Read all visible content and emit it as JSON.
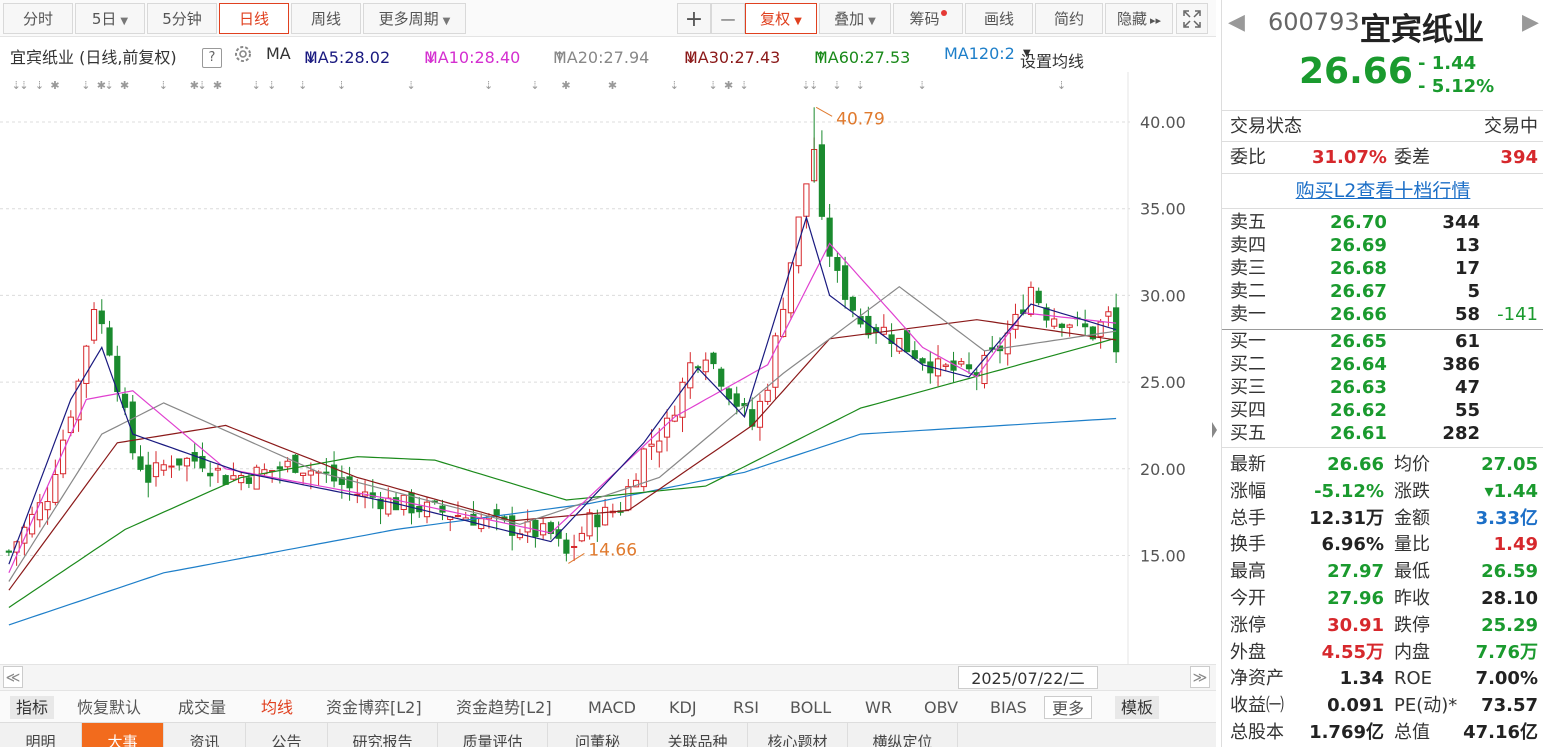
{
  "toolbar": {
    "periods": [
      "分时",
      "5日",
      "5分钟",
      "日线",
      "周线",
      "更多周期"
    ],
    "active_period": "日线",
    "tools": [
      "+",
      "—"
    ],
    "fuquan": "复权",
    "overlay": "叠加",
    "chouma": "筹码",
    "huaxian": "画线",
    "jianyue": "简约",
    "hide": "隐藏",
    "hide_arrows": "▸▸",
    "fullscreen_icon": "fullscreen"
  },
  "maline": {
    "stock_label": "宜宾纸业 (日线,前复权)",
    "help": "?",
    "ma_label": "MA",
    "ma5": "MA5:28.02",
    "ma5_arrow": "↓",
    "ma10": "MA10:28.40",
    "ma10_arrow": "↓",
    "ma20": "MA20:27.94",
    "ma20_arrow": "↑",
    "ma30": "MA30:27.43",
    "ma30_arrow": "↓",
    "ma60": "MA60:27.53",
    "ma60_arrow": "↑",
    "ma120": "MA120:2",
    "set_ma": "设置均线",
    "colors": {
      "ma5": "#1a1a80",
      "ma10": "#e040d0",
      "ma20": "#888888",
      "ma30": "#8b1a1a",
      "ma60": "#1b8a1b",
      "ma120": "#1e7fc9"
    }
  },
  "chart_data": {
    "type": "candlestick",
    "y_ticks": [
      "40.00",
      "35.00",
      "30.00",
      "25.00",
      "20.00",
      "15.00"
    ],
    "y_tick_values": [
      40,
      35,
      30,
      25,
      20,
      15
    ],
    "max_label": "40.79",
    "min_label": "14.66",
    "last_close": 26.66,
    "up_color": "#d6282c",
    "down_color": "#1a8a2e",
    "anchor_closes": [
      [
        0,
        15.2
      ],
      [
        5,
        18.5
      ],
      [
        9,
        25.0
      ],
      [
        11,
        29.5
      ],
      [
        13,
        27.0
      ],
      [
        16,
        21.0
      ],
      [
        18,
        19.5
      ],
      [
        21,
        20.5
      ],
      [
        25,
        20.5
      ],
      [
        28,
        19.5
      ],
      [
        33,
        19.8
      ],
      [
        37,
        20.3
      ],
      [
        41,
        19.6
      ],
      [
        45,
        18.6
      ],
      [
        50,
        18.0
      ],
      [
        55,
        17.6
      ],
      [
        60,
        17.2
      ],
      [
        65,
        16.6
      ],
      [
        70,
        16.2
      ],
      [
        72,
        15.0
      ],
      [
        75,
        17.0
      ],
      [
        79,
        17.8
      ],
      [
        82,
        21.0
      ],
      [
        85,
        22.5
      ],
      [
        88,
        26.0
      ],
      [
        90,
        26.8
      ],
      [
        93,
        24.5
      ],
      [
        96,
        22.5
      ],
      [
        98,
        25.0
      ],
      [
        101,
        32.0
      ],
      [
        103,
        36.5
      ],
      [
        104,
        38.5
      ],
      [
        105,
        34.0
      ],
      [
        107,
        31.0
      ],
      [
        110,
        28.5
      ],
      [
        113,
        28.0
      ],
      [
        116,
        27.0
      ],
      [
        120,
        25.8
      ],
      [
        125,
        25.5
      ],
      [
        128,
        27.0
      ],
      [
        130,
        28.5
      ],
      [
        132,
        30.5
      ],
      [
        134,
        29.0
      ],
      [
        137,
        28.5
      ],
      [
        140,
        27.8
      ],
      [
        142,
        28.8
      ],
      [
        143,
        26.66
      ]
    ],
    "ma_curves": {
      "ma120": [
        [
          0,
          11.0
        ],
        [
          20,
          14.0
        ],
        [
          50,
          16.5
        ],
        [
          75,
          18.0
        ],
        [
          95,
          19.8
        ],
        [
          110,
          22.0
        ],
        [
          143,
          22.9
        ]
      ],
      "ma60": [
        [
          0,
          12.0
        ],
        [
          15,
          16.5
        ],
        [
          30,
          19.5
        ],
        [
          45,
          20.7
        ],
        [
          55,
          20.5
        ],
        [
          72,
          18.2
        ],
        [
          90,
          19.0
        ],
        [
          110,
          23.5
        ],
        [
          143,
          27.53
        ]
      ],
      "ma30": [
        [
          0,
          13.0
        ],
        [
          14,
          21.5
        ],
        [
          28,
          22.5
        ],
        [
          45,
          19.5
        ],
        [
          65,
          17.0
        ],
        [
          80,
          17.6
        ],
        [
          96,
          22.5
        ],
        [
          106,
          27.5
        ],
        [
          125,
          28.6
        ],
        [
          143,
          27.43
        ]
      ],
      "ma20": [
        [
          0,
          13.5
        ],
        [
          12,
          22.0
        ],
        [
          20,
          23.8
        ],
        [
          40,
          19.8
        ],
        [
          66,
          16.8
        ],
        [
          84,
          19.5
        ],
        [
          100,
          25.5
        ],
        [
          115,
          30.5
        ],
        [
          126,
          26.8
        ],
        [
          143,
          27.94
        ]
      ],
      "ma10": [
        [
          0,
          14.0
        ],
        [
          10,
          24.0
        ],
        [
          16,
          24.5
        ],
        [
          28,
          20.0
        ],
        [
          50,
          18.2
        ],
        [
          70,
          16.3
        ],
        [
          86,
          23.0
        ],
        [
          98,
          26.0
        ],
        [
          106,
          33.0
        ],
        [
          118,
          27.0
        ],
        [
          125,
          25.3
        ],
        [
          131,
          29.0
        ],
        [
          143,
          28.4
        ]
      ],
      "ma5": [
        [
          0,
          14.5
        ],
        [
          8,
          24.0
        ],
        [
          12,
          27.0
        ],
        [
          16,
          22.0
        ],
        [
          30,
          19.8
        ],
        [
          50,
          18.0
        ],
        [
          70,
          15.8
        ],
        [
          82,
          21.5
        ],
        [
          89,
          25.8
        ],
        [
          95,
          23.0
        ],
        [
          103,
          34.5
        ],
        [
          106,
          30.0
        ],
        [
          112,
          28.0
        ],
        [
          118,
          26.0
        ],
        [
          124,
          25.3
        ],
        [
          132,
          29.5
        ],
        [
          143,
          28.02
        ]
      ]
    }
  },
  "datebar": {
    "left_arrow": "≪",
    "date": "2025/07/22/二",
    "right_arrow": "≫"
  },
  "indicators": [
    "指标",
    "恢复默认",
    "成交量",
    "均线",
    "资金博弈[L2]",
    "资金趋势[L2]",
    "MACD",
    "KDJ",
    "RSI",
    "BOLL",
    "WR",
    "OBV",
    "BIAS",
    "更多",
    "模板"
  ],
  "active_indicator": "均线",
  "bottom_tabs": [
    "明明",
    "大事",
    "资讯",
    "公告",
    "研究报告",
    "质量评估",
    "问董秘",
    "关联品种",
    "核心题材",
    "横纵定位"
  ],
  "active_tab": "大事",
  "right": {
    "prev_arrow": "◀",
    "next_arrow": "▶",
    "code": "600793",
    "name": "宜宾纸业",
    "price": "26.66",
    "change": "- 1.44",
    "change_pct": "- 5.12%",
    "status_label": "交易状态",
    "status_value": "交易中",
    "weibi_label": "委比",
    "weibi_value": "31.07%",
    "weicha_label": "委差",
    "weicha_value": "394",
    "l2_link": "购买L2查看十档行情",
    "asks": [
      {
        "label": "卖五",
        "price": "26.70",
        "vol": "344",
        "extra": ""
      },
      {
        "label": "卖四",
        "price": "26.69",
        "vol": "13",
        "extra": ""
      },
      {
        "label": "卖三",
        "price": "26.68",
        "vol": "17",
        "extra": ""
      },
      {
        "label": "卖二",
        "price": "26.67",
        "vol": "5",
        "extra": ""
      },
      {
        "label": "卖一",
        "price": "26.66",
        "vol": "58",
        "extra": "-141"
      }
    ],
    "bids": [
      {
        "label": "买一",
        "price": "26.65",
        "vol": "61"
      },
      {
        "label": "买二",
        "price": "26.64",
        "vol": "386"
      },
      {
        "label": "买三",
        "price": "26.63",
        "vol": "47"
      },
      {
        "label": "买四",
        "price": "26.62",
        "vol": "55"
      },
      {
        "label": "买五",
        "price": "26.61",
        "vol": "282"
      }
    ],
    "stats": [
      {
        "l1": "最新",
        "v1": "26.66",
        "c1": "grn",
        "l2": "均价",
        "v2": "27.05",
        "c2": "grn"
      },
      {
        "l1": "涨幅",
        "v1": "-5.12%",
        "c1": "grn",
        "l2": "涨跌",
        "v2": "▾1.44",
        "c2": "grn"
      },
      {
        "l1": "总手",
        "v1": "12.31万",
        "c1": "blk",
        "l2": "金额",
        "v2": "3.33亿",
        "c2": "blu"
      },
      {
        "l1": "换手",
        "v1": "6.96%",
        "c1": "blk",
        "l2": "量比",
        "v2": "1.49",
        "c2": "red"
      },
      {
        "l1": "最高",
        "v1": "27.97",
        "c1": "grn",
        "l2": "最低",
        "v2": "26.59",
        "c2": "grn"
      },
      {
        "l1": "今开",
        "v1": "27.96",
        "c1": "grn",
        "l2": "昨收",
        "v2": "28.10",
        "c2": "blk"
      },
      {
        "l1": "涨停",
        "v1": "30.91",
        "c1": "red",
        "l2": "跌停",
        "v2": "25.29",
        "c2": "grn"
      },
      {
        "l1": "外盘",
        "v1": "4.55万",
        "c1": "red",
        "l2": "内盘",
        "v2": "7.76万",
        "c2": "grn"
      },
      {
        "l1": "净资产",
        "v1": "1.34",
        "c1": "blk",
        "l2": "ROE",
        "v2": "7.00%",
        "c2": "blk"
      },
      {
        "l1": "收益㈠",
        "v1": "0.091",
        "c1": "blk",
        "l2": "PE(动)*",
        "v2": "73.57",
        "c2": "blk"
      },
      {
        "l1": "总股本",
        "v1": "1.769亿",
        "c1": "blk",
        "l2": "总值",
        "v2": "47.16亿",
        "c2": "blk"
      }
    ]
  }
}
